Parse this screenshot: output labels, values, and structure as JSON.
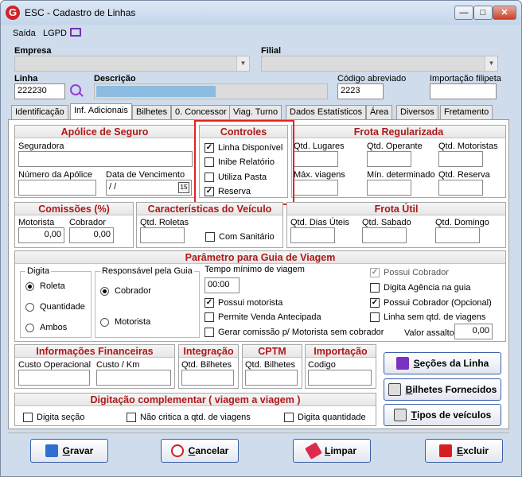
{
  "window": {
    "title": "ESC - Cadastro de Linhas",
    "logo_letter": "G"
  },
  "menu": {
    "items": [
      "Saída",
      "LGPD"
    ],
    "monitor_icon": "monitor-icon"
  },
  "header": {
    "empresa_label": "Empresa",
    "filial_label": "Filial",
    "linha_label": "Linha",
    "linha_value": "222230",
    "descricao_label": "Descrição",
    "codigo_label": "Código abreviado",
    "codigo_value": "2223",
    "importacao_label": "Importação filipeta"
  },
  "tabs": [
    "Identificação",
    "Inf. Adicionais",
    "Bilhetes",
    "0. Concessor",
    "Viag. Turno",
    "Dados Estatísticos",
    "Área",
    "Diversos",
    "Fretamento"
  ],
  "active_tab": "Inf. Adicionais",
  "apolice": {
    "title": "Apólice de Seguro",
    "seguradora": "Seguradora",
    "numero": "Número da Apólice",
    "data_label": "Data de Vencimento",
    "data_value": "/  /",
    "calendar_day": "15"
  },
  "controles": {
    "title": "Controles",
    "items": [
      {
        "label": "Linha Disponível",
        "checked": true
      },
      {
        "label": "Inibe Relatório",
        "checked": false
      },
      {
        "label": "Utiliza Pasta",
        "checked": false
      },
      {
        "label": "Reserva",
        "checked": true
      }
    ]
  },
  "frota_regularizada": {
    "title": "Frota Regularizada",
    "fields": [
      "Qtd. Lugares",
      "Qtd. Operante",
      "Qtd. Motoristas",
      "Máx. viagens",
      "Mín. determinado",
      "Qtd. Reserva"
    ]
  },
  "comissoes": {
    "title": "Comissões (%)",
    "motorista_label": "Motorista",
    "motorista_value": "0,00",
    "cobrador_label": "Cobrador",
    "cobrador_value": "0,00"
  },
  "caracteristicas": {
    "title": "Características do Veículo",
    "roletas_label": "Qtd. Roletas",
    "sanitario_label": "Com Sanitário"
  },
  "frota_util": {
    "title": "Frota Útil",
    "fields": [
      "Qtd. Dias Úteis",
      "Qtd. Sabado",
      "Qtd. Domingo"
    ]
  },
  "parametro": {
    "title": "Parâmetro para Guia de Viagem",
    "digita_label": "Digita",
    "digita_options": [
      {
        "label": "Roleta",
        "selected": true
      },
      {
        "label": "Quantidade",
        "selected": false
      },
      {
        "label": "Ambos",
        "selected": false
      }
    ],
    "responsavel_label": "Responsável pela Guia",
    "responsavel_options": [
      {
        "label": "Cobrador",
        "selected": true
      },
      {
        "label": "Motorista",
        "selected": false
      }
    ],
    "tempo_label": "Tempo mínimo de viagem",
    "tempo_value": "00:00",
    "mid_checks": [
      {
        "label": "Possui motorista",
        "checked": true
      },
      {
        "label": "Permite Venda Antecipada",
        "checked": false
      },
      {
        "label": "Gerar comissão p/ Motorista sem cobrador",
        "checked": false
      }
    ],
    "right_checks": [
      {
        "label": "Possui Cobrador",
        "checked": true,
        "disabled": true
      },
      {
        "label": "Digita Agência na guia",
        "checked": false
      },
      {
        "label": "Possui Cobrador (Opcional)",
        "checked": true
      },
      {
        "label": "Linha sem  qtd. de viagens",
        "checked": false
      }
    ],
    "valor_assalto_label": "Valor assalto:",
    "valor_assalto_value": "0,00"
  },
  "financeiras": {
    "title": "Informações Financeiras",
    "custo_op": "Custo Operacional",
    "custo_km": "Custo / Km"
  },
  "integracao": {
    "title": "Integração",
    "field": "Qtd. Bilhetes"
  },
  "cptm": {
    "title": "CPTM",
    "field": "Qtd. Bilhetes"
  },
  "importacao": {
    "title": "Importação",
    "field": "Codigo"
  },
  "side_buttons": {
    "secoes": {
      "underlined": "S",
      "rest": "eções da Linha"
    },
    "bilhetes": {
      "underlined": "B",
      "rest": "ilhetes Fornecidos"
    },
    "tipos": {
      "underlined": "T",
      "rest": "ipos de veículos"
    }
  },
  "digitacao": {
    "title": "Digitação complementar ( viagem a viagem )",
    "checks": [
      "Digita seção",
      "Não critica a qtd. de  viagens",
      "Digita quantidade"
    ]
  },
  "footer_buttons": {
    "gravar": {
      "underlined": "G",
      "rest": "ravar"
    },
    "cancelar": {
      "underlined": "C",
      "rest": "ancelar"
    },
    "limpar": {
      "underlined": "L",
      "rest": "impar"
    },
    "excluir": {
      "underlined": "E",
      "rest": "xcluir"
    }
  },
  "colors": {
    "accent_red": "#b01818",
    "highlight_box": "#e02424"
  }
}
